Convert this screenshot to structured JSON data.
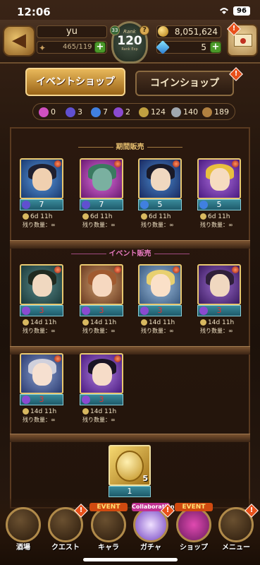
{
  "status_bar": {
    "time": "12:06",
    "battery": "96"
  },
  "header": {
    "player_name": "yu",
    "stamina": "465/119",
    "rank_label": "Rank",
    "rank_value": "120",
    "rank_sub": "Rank Exp",
    "rank_badge": "33",
    "coins": "8,051,624",
    "gems": "5"
  },
  "tabs": {
    "event_shop": "イベントショップ",
    "coin_shop": "コインショップ"
  },
  "currencies": [
    {
      "icon": "pink-medal-icon",
      "value": "0",
      "color": "#d050c0"
    },
    {
      "icon": "purple-medal-icon",
      "value": "3",
      "color": "#6050d0"
    },
    {
      "icon": "blue-medal-icon",
      "value": "7",
      "color": "#4080e0"
    },
    {
      "icon": "violet-medal-icon",
      "value": "2",
      "color": "#8a4ad0"
    },
    {
      "icon": "gold-medal-icon",
      "value": "124",
      "color": "#c0a040"
    },
    {
      "icon": "silver-medal-icon",
      "value": "140",
      "color": "#a0a8b0"
    },
    {
      "icon": "bronze-medal-icon",
      "value": "189",
      "color": "#b08040"
    }
  ],
  "sections": {
    "limited": "期間販売",
    "event": "イベント販売"
  },
  "limited_items": [
    {
      "price": "7",
      "time": "6d 11h",
      "stock": "残り数量：∞",
      "hair": "#202030",
      "bg": "#2a6ab0"
    },
    {
      "price": "7",
      "time": "6d 11h",
      "stock": "残り数量：∞",
      "hair": "#3a7a60",
      "bg": "#a040a0"
    },
    {
      "price": "5",
      "time": "6d 11h",
      "stock": "残り数量：∞",
      "hair": "#1a1a28",
      "bg": "#2a5a90"
    },
    {
      "price": "5",
      "time": "6d 11h",
      "stock": "残り数量：∞",
      "hair": "#e8c040",
      "bg": "#7040b0"
    }
  ],
  "event_items": [
    {
      "price": "3",
      "time": "14d 11h",
      "stock": "残り数量：∞",
      "hair": "#202a20",
      "bg": "#3a6a6a"
    },
    {
      "price": "3",
      "time": "14d 11h",
      "stock": "残り数量：∞",
      "hair": "#a05a30",
      "bg": "#a06a40"
    },
    {
      "price": "3",
      "time": "14d 11h",
      "stock": "残り数量：∞",
      "hair": "#e8d070",
      "bg": "#6a8ab0"
    },
    {
      "price": "3",
      "time": "14d 11h",
      "stock": "残り数量：∞",
      "hair": "#30203a",
      "bg": "#6a4aa0"
    },
    {
      "price": "3",
      "time": "14d 11h",
      "stock": "残り数量：∞",
      "hair": "#d0d0dc",
      "bg": "#5a70a0"
    },
    {
      "price": "3",
      "time": "14d 11h",
      "stock": "残り数量：∞",
      "hair": "#1a1424",
      "bg": "#7a4ab0"
    }
  ],
  "coin_item": {
    "count": "5",
    "price": "1"
  },
  "nav": [
    {
      "label": "酒場",
      "tag": "",
      "icon": "tavern-icon"
    },
    {
      "label": "クエスト",
      "tag": "",
      "icon": "quest-icon"
    },
    {
      "label": "キャラ",
      "tag": "EVENT",
      "icon": "character-icon"
    },
    {
      "label": "ガチャ",
      "tag": "Collaboration",
      "icon": "gacha-icon"
    },
    {
      "label": "ショップ",
      "tag": "EVENT",
      "icon": "shop-icon"
    },
    {
      "label": "メニュー",
      "tag": "",
      "icon": "menu-gear-icon"
    }
  ]
}
